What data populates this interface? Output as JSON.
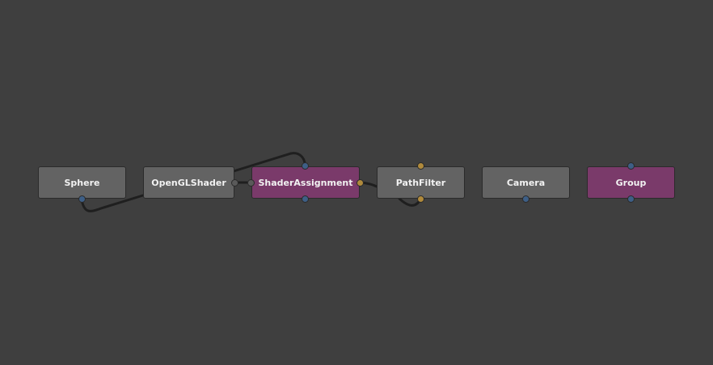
{
  "app": {
    "background_color": "#3f3f3f"
  },
  "colors": {
    "node_gray": "#636363",
    "node_purple": "#7a3a6a",
    "plug_blue": "#3e5f86",
    "plug_orange": "#b08a3c",
    "plug_gray": "#5a5a5a",
    "connection_line": "#1f1f1f"
  },
  "nodes": [
    {
      "id": "sphere",
      "label": "Sphere",
      "color": "gray"
    },
    {
      "id": "openglshader",
      "label": "OpenGLShader",
      "color": "gray"
    },
    {
      "id": "shaderassignment",
      "label": "ShaderAssignment",
      "color": "purple"
    },
    {
      "id": "pathfilter",
      "label": "PathFilter",
      "color": "gray"
    },
    {
      "id": "camera",
      "label": "Camera",
      "color": "gray"
    },
    {
      "id": "group",
      "label": "Group",
      "color": "purple"
    }
  ],
  "plug_kinds": {
    "sphere_out": "scene",
    "openglshader_out": "shader",
    "shaderassignment_shader_in": "shader",
    "shaderassignment_in": "scene",
    "shaderassignment_out": "scene",
    "shaderassignment_filter_in": "filter",
    "pathfilter_in": "filter",
    "pathfilter_out": "filter",
    "camera_out": "scene",
    "group_in": "scene",
    "group_out": "scene"
  }
}
